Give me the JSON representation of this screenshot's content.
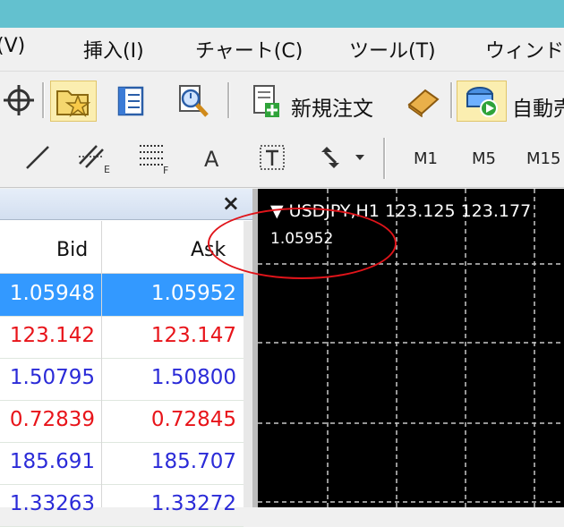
{
  "menu": [
    "(V)",
    "挿入(I)",
    "チャート(C)",
    "ツール(T)",
    "ウィンドウ"
  ],
  "toolbar": {
    "new_order_label": "新規注文",
    "auto_trade_label": "自動売"
  },
  "timeframes": [
    "M1",
    "M5",
    "M15"
  ],
  "drawing_text_tool": "A",
  "market_watch": {
    "columns": {
      "bid": "Bid",
      "ask": "Ask"
    },
    "rows": [
      {
        "bid": "1.05948",
        "ask": "1.05952",
        "color": "#ffffff",
        "selected": true
      },
      {
        "bid": "123.142",
        "ask": "123.147",
        "color": "#e8141a",
        "selected": false
      },
      {
        "bid": "1.50795",
        "ask": "1.50800",
        "color": "#2b2bd8",
        "selected": false
      },
      {
        "bid": "0.72839",
        "ask": "0.72845",
        "color": "#e8141a",
        "selected": false
      },
      {
        "bid": "185.691",
        "ask": "185.707",
        "color": "#2b2bd8",
        "selected": false
      },
      {
        "bid": "1.33263",
        "ask": "1.33272",
        "color": "#2b2bd8",
        "selected": false
      }
    ]
  },
  "chart": {
    "title": "USDJPY,H1  123.125 123.177",
    "value": "1.05952",
    "grid_color": "#c8c8c8",
    "background": "#000000"
  },
  "colors": {
    "titlebar": "#63c1cf",
    "selection": "#3399ff",
    "annotation": "#e0141a"
  }
}
